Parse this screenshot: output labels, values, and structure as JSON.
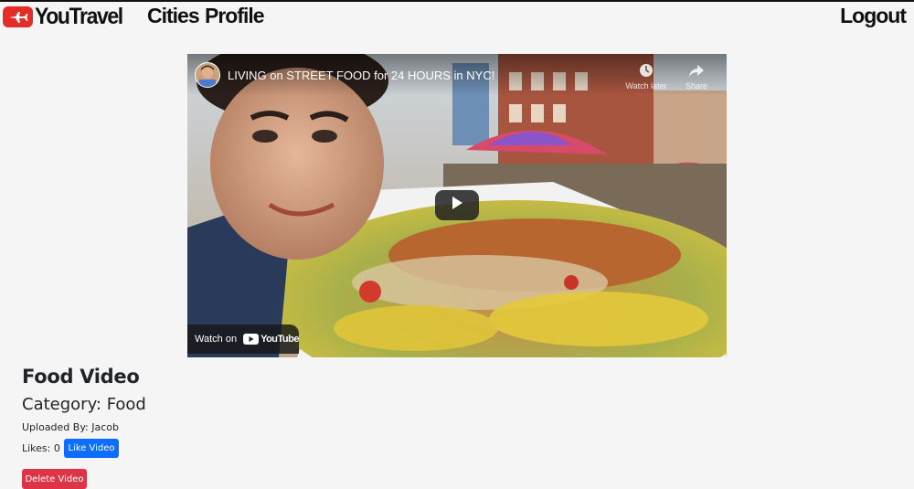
{
  "nav": {
    "brand": "YouTravel",
    "cities": "Cities",
    "profile": "Profile",
    "logout": "Logout"
  },
  "video": {
    "title": "LIVING on STREET FOOD for 24 HOURS in NYC!",
    "watch_later": "Watch later",
    "share": "Share",
    "watch_on": "Watch on",
    "youtube": "YouTube"
  },
  "details": {
    "heading": "Food Video",
    "category": "Category: Food",
    "uploaded_by": "Uploaded By: Jacob",
    "likes": "Likes: 0",
    "like_button": "Like Video",
    "delete_button": "Delete Video"
  },
  "colors": {
    "brand_red": "#e52d27",
    "like_blue": "#0d6efd",
    "delete_red": "#dc3545",
    "page_bg": "#f5f5f5"
  },
  "icons": {
    "brand": "airplane-icon",
    "play": "play-icon",
    "watch_later": "clock-icon",
    "share": "share-arrow-icon",
    "youtube": "youtube-logo-icon"
  }
}
